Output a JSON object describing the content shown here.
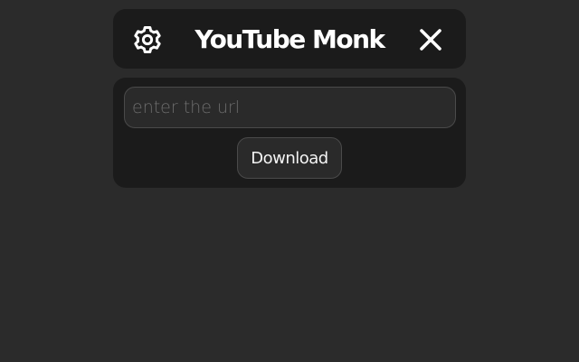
{
  "header": {
    "title": "YouTube Monk",
    "settings_icon": "gear-icon",
    "close_icon": "close-icon"
  },
  "form": {
    "url_placeholder": "enter the url",
    "url_value": "",
    "download_label": "Download"
  },
  "colors": {
    "background": "#2b2b2b",
    "card": "#1b1b1b",
    "field": "#2a2a2a",
    "border": "#4a4a4a",
    "text": "#ffffff"
  }
}
